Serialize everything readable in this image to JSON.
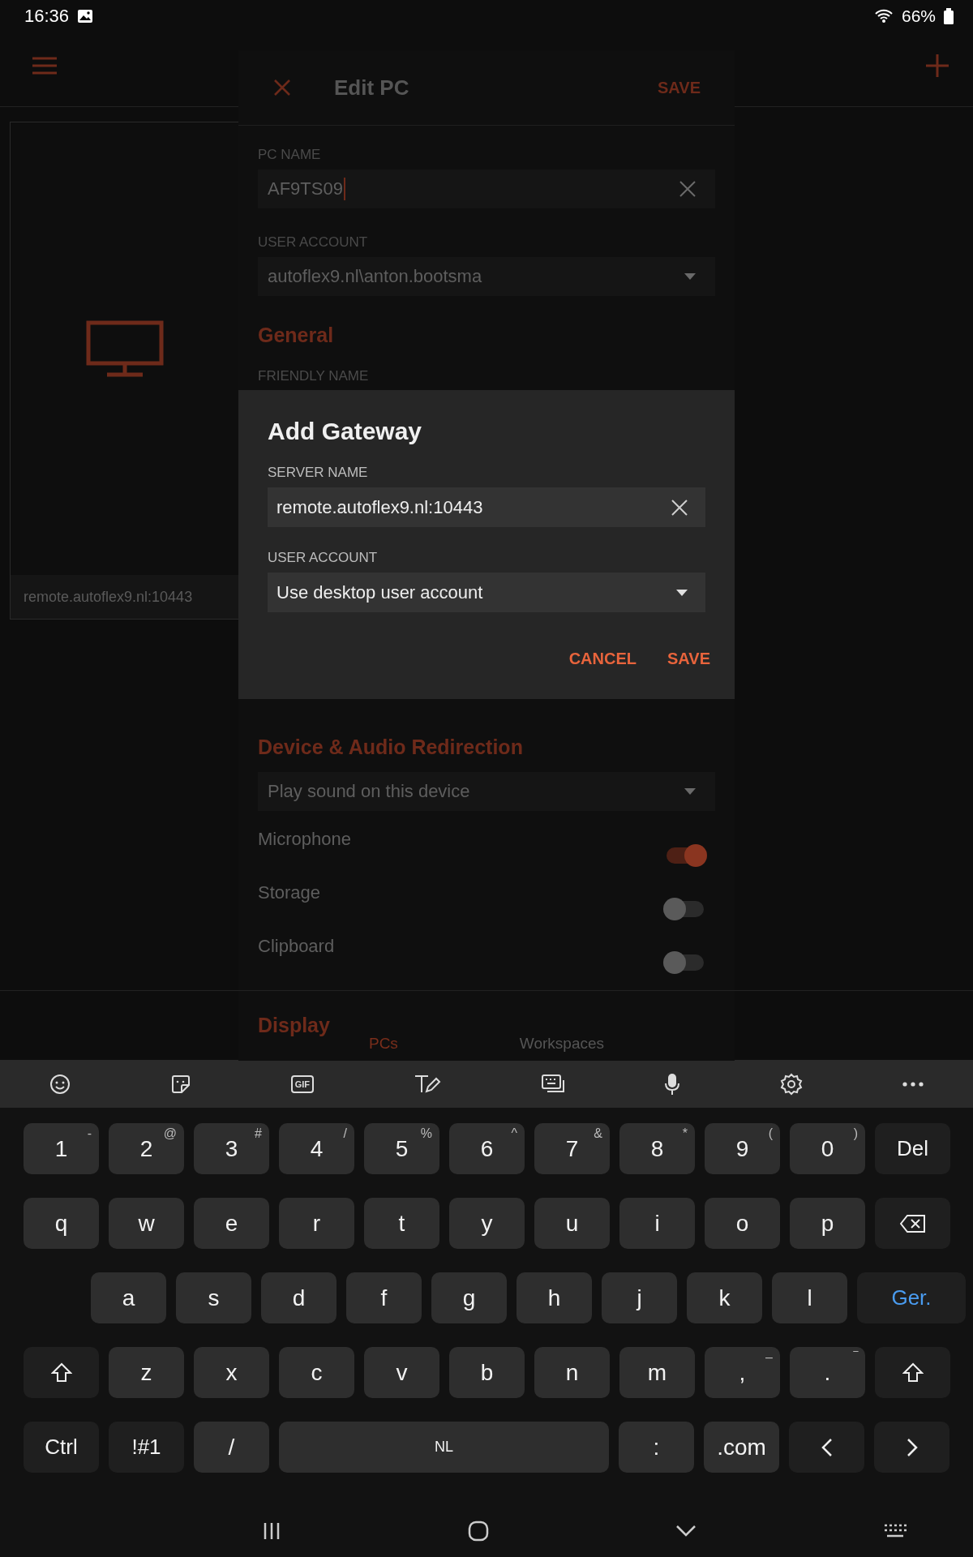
{
  "status_bar": {
    "time": "16:36",
    "battery": "66%"
  },
  "pc_card": {
    "footer": "remote.autoflex9.nl:10443"
  },
  "bottom_nav": [
    {
      "label": "PCs",
      "selected": true
    },
    {
      "label": "Workspaces",
      "selected": false
    }
  ],
  "edit_pc": {
    "title": "Edit PC",
    "save": "SAVE",
    "pc_name": {
      "label": "PC NAME",
      "value": "AF9TS09"
    },
    "user_account": {
      "label": "USER ACCOUNT",
      "value": "autoflex9.nl\\anton.bootsma"
    },
    "general": {
      "heading": "General",
      "friendly_name_label": "FRIENDLY NAME"
    },
    "device_audio": {
      "heading": "Device & Audio Redirection",
      "sound": "Play sound on this device",
      "toggles": [
        {
          "label": "Microphone",
          "on": true
        },
        {
          "label": "Storage",
          "on": false
        },
        {
          "label": "Clipboard",
          "on": false
        }
      ]
    },
    "display": {
      "heading": "Display"
    }
  },
  "dialog": {
    "title": "Add Gateway",
    "server_label": "SERVER NAME",
    "server_value": "remote.autoflex9.nl:10443",
    "account_label": "USER ACCOUNT",
    "account_value": "Use desktop user account",
    "cancel": "CANCEL",
    "save": "SAVE"
  },
  "keyboard": {
    "toolbar": [
      {
        "kind": "emoji"
      },
      {
        "kind": "sticker"
      },
      {
        "kind": "gif",
        "label": "GIF"
      },
      {
        "kind": "handwriting"
      },
      {
        "kind": "keyboard"
      },
      {
        "kind": "mic"
      },
      {
        "kind": "settings"
      },
      {
        "kind": "more"
      }
    ],
    "rows": [
      {
        "keys": [
          {
            "kind": "char",
            "label": "1",
            "hint": "-"
          },
          {
            "kind": "char",
            "label": "2",
            "hint": "@"
          },
          {
            "kind": "char",
            "label": "3",
            "hint": "#"
          },
          {
            "kind": "char",
            "label": "4",
            "hint": "/"
          },
          {
            "kind": "char",
            "label": "5",
            "hint": "%"
          },
          {
            "kind": "char",
            "label": "6",
            "hint": "^"
          },
          {
            "kind": "char",
            "label": "7",
            "hint": "&"
          },
          {
            "kind": "char",
            "label": "8",
            "hint": "*"
          },
          {
            "kind": "char",
            "label": "9",
            "hint": "("
          },
          {
            "kind": "char",
            "label": "0",
            "hint": ")"
          },
          {
            "kind": "func",
            "label": "Del"
          }
        ]
      },
      {
        "keys": [
          {
            "kind": "char",
            "label": "q"
          },
          {
            "kind": "char",
            "label": "w"
          },
          {
            "kind": "char",
            "label": "e"
          },
          {
            "kind": "char",
            "label": "r"
          },
          {
            "kind": "char",
            "label": "t"
          },
          {
            "kind": "char",
            "label": "y"
          },
          {
            "kind": "char",
            "label": "u"
          },
          {
            "kind": "char",
            "label": "i"
          },
          {
            "kind": "char",
            "label": "o"
          },
          {
            "kind": "char",
            "label": "p"
          },
          {
            "kind": "backspace"
          }
        ]
      },
      {
        "keys": [
          {
            "kind": "char",
            "label": "a"
          },
          {
            "kind": "char",
            "label": "s"
          },
          {
            "kind": "char",
            "label": "d"
          },
          {
            "kind": "char",
            "label": "f"
          },
          {
            "kind": "char",
            "label": "g"
          },
          {
            "kind": "char",
            "label": "h"
          },
          {
            "kind": "char",
            "label": "j"
          },
          {
            "kind": "char",
            "label": "k"
          },
          {
            "kind": "char",
            "label": "l"
          },
          {
            "kind": "enter",
            "label": "Ger."
          }
        ]
      },
      {
        "keys": [
          {
            "kind": "shift"
          },
          {
            "kind": "char",
            "label": "z"
          },
          {
            "kind": "char",
            "label": "x"
          },
          {
            "kind": "char",
            "label": "c"
          },
          {
            "kind": "char",
            "label": "v"
          },
          {
            "kind": "char",
            "label": "b"
          },
          {
            "kind": "char",
            "label": "n"
          },
          {
            "kind": "char",
            "label": "m"
          },
          {
            "kind": "char",
            "label": ",",
            "hint": "–"
          },
          {
            "kind": "char",
            "label": ".",
            "hint": "‾"
          },
          {
            "kind": "shift"
          }
        ]
      },
      {
        "keys": [
          {
            "kind": "func",
            "label": "Ctrl"
          },
          {
            "kind": "func",
            "label": "!#1"
          },
          {
            "kind": "char",
            "label": "/"
          },
          {
            "kind": "space",
            "label": "NL"
          },
          {
            "kind": "char",
            "label": ":"
          },
          {
            "kind": "char",
            "label": ".com"
          },
          {
            "kind": "left"
          },
          {
            "kind": "right"
          }
        ]
      }
    ]
  }
}
